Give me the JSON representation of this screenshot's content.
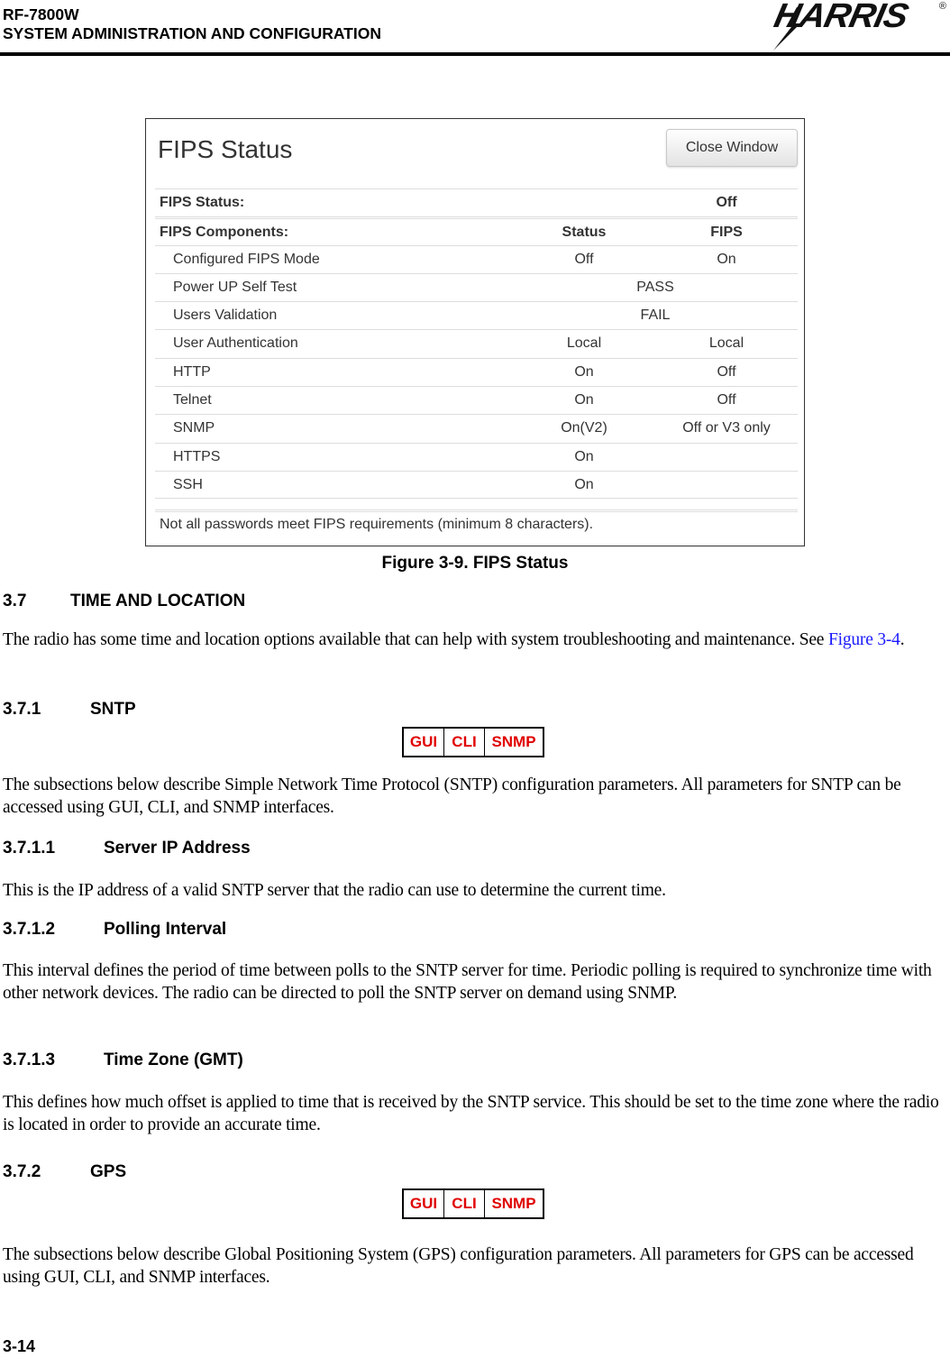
{
  "header": {
    "product": "RF-7800W",
    "subtitle": "SYSTEM ADMINISTRATION AND CONFIGURATION",
    "logo_text": "HARRIS",
    "logo_reg": "®"
  },
  "figure": {
    "window_title": "FIPS Status",
    "close_button": "Close Window",
    "fips_status_label": "FIPS Status:",
    "fips_status_value": "Off",
    "components_header": {
      "label": "FIPS Components:",
      "status": "Status",
      "fips": "FIPS"
    },
    "rows": [
      {
        "label": "Configured FIPS Mode",
        "status": "Off",
        "fips": "On"
      },
      {
        "label": "Power UP Self Test",
        "merged": "PASS"
      },
      {
        "label": "Users Validation",
        "merged": "FAIL"
      },
      {
        "label": "User Authentication",
        "status": "Local",
        "fips": "Local"
      },
      {
        "label": "HTTP",
        "status": "On",
        "fips": "Off"
      },
      {
        "label": "Telnet",
        "status": "On",
        "fips": "Off"
      },
      {
        "label": "SNMP",
        "status": "On(V2)",
        "fips": "Off or V3 only"
      },
      {
        "label": "HTTPS",
        "status": "On",
        "fips": ""
      },
      {
        "label": "SSH",
        "status": "On",
        "fips": ""
      }
    ],
    "note": "Not all passwords meet FIPS requirements (minimum 8 characters).",
    "caption": "Figure 3-9.  FIPS Status"
  },
  "sections": {
    "s37": {
      "num": "3.7",
      "title": "TIME AND LOCATION",
      "para_a": "The radio has some time and location options available that can help with system troubleshooting and maintenance. See ",
      "link": "Figure 3-4",
      "para_b": "."
    },
    "s371": {
      "num": "3.7.1",
      "title": "SNTP",
      "para": "The subsections below describe Simple Network Time Protocol (SNTP) configuration parameters. All parameters for SNTP can be accessed using GUI, CLI, and SNMP interfaces."
    },
    "s3711": {
      "num": "3.7.1.1",
      "title": "Server IP Address",
      "para": "This is the IP address of a valid SNTP server that the radio can use to determine the current time."
    },
    "s3712": {
      "num": "3.7.1.2",
      "title": "Polling Interval",
      "para": "This interval defines the period of time between polls to the SNTP server for time. Periodic polling is required to synchronize time with other network devices. The radio can be directed to poll the SNTP server on demand using SNMP."
    },
    "s3713": {
      "num": "3.7.1.3",
      "title": "Time Zone (GMT)",
      "para": "This defines how much offset is applied to time that is received by the SNTP service. This should be set to the time zone where the radio is located in order to provide an accurate time."
    },
    "s372": {
      "num": "3.7.2",
      "title": "GPS",
      "para": "The subsections below describe Global Positioning System (GPS) configuration parameters. All parameters for GPS can be accessed using GUI, CLI, and SNMP interfaces."
    }
  },
  "interfaces": [
    "GUI",
    "CLI",
    "SNMP"
  ],
  "colors": {
    "interface_text": "#e00000",
    "link": "#1a1aff"
  },
  "footer": {
    "page_number": "3-14"
  }
}
